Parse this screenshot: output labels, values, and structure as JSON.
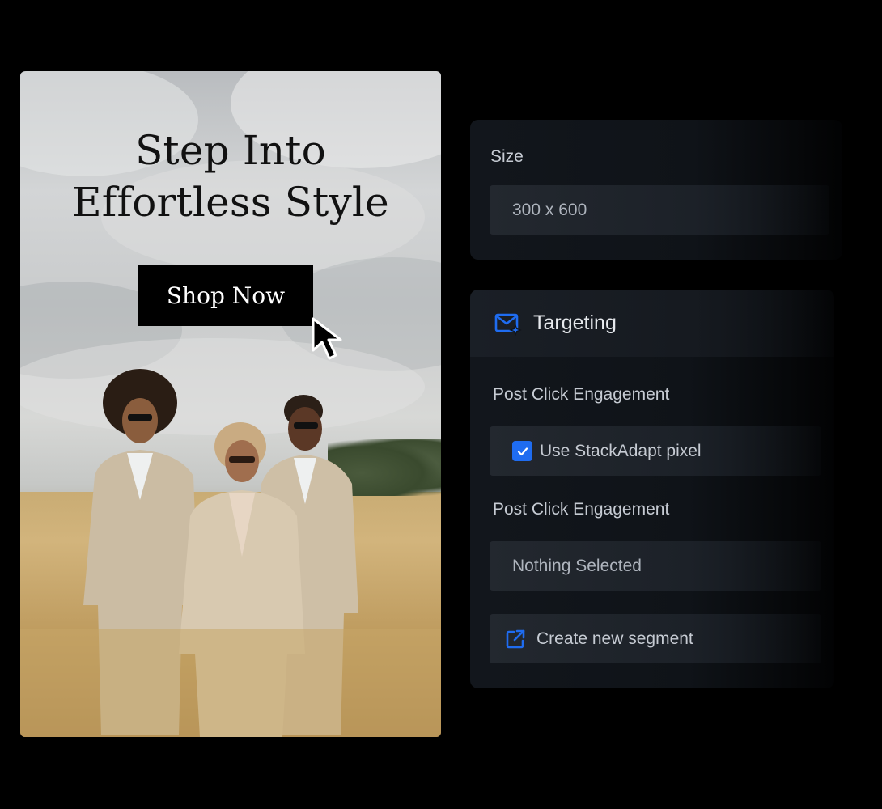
{
  "ad": {
    "headline_line1": "Step Into",
    "headline_line2": "Effortless Style",
    "cta_label": "Shop Now"
  },
  "size_panel": {
    "label": "Size",
    "value": "300 x 600"
  },
  "targeting": {
    "title": "Targeting",
    "post_click_label_1": "Post Click Engagement",
    "pixel_checkbox": {
      "label": "Use StackAdapt pixel",
      "checked": true
    },
    "post_click_label_2": "Post Click Engagement",
    "segment_select_value": "Nothing Selected",
    "create_segment_label": "Create new segment"
  },
  "colors": {
    "accent": "#1f6cf0",
    "background": "#000000",
    "panel": "#12161c"
  },
  "icons": [
    "cursor-arrow-icon",
    "mail-sparkle-icon",
    "check-icon",
    "external-link-icon"
  ]
}
